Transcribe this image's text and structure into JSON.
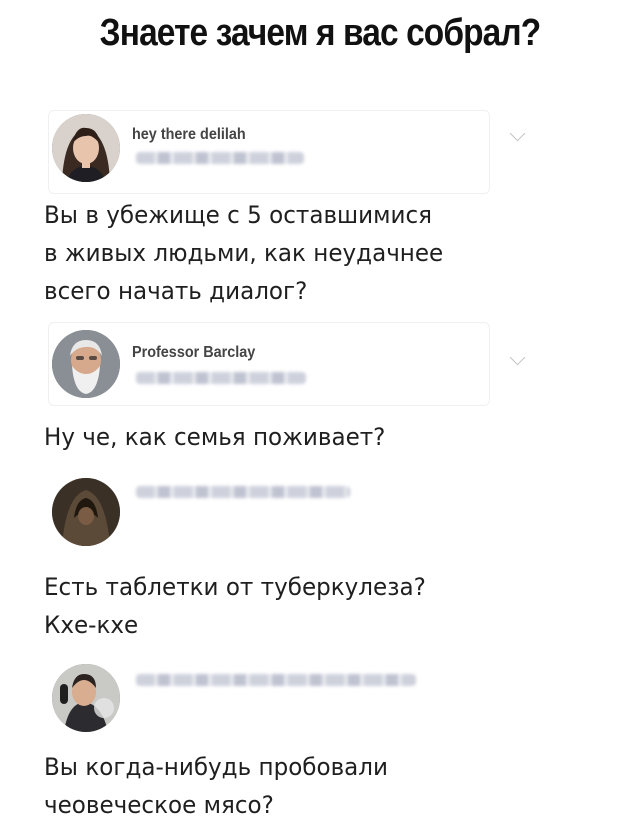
{
  "meme": {
    "title": "Знаете зачем я вас собрал?"
  },
  "posts": [
    {
      "username": "hey there delilah",
      "text": "Вы в убежище с 5 оставшимися\nв живых людьми, как неудачнее\nвсего начать диалог?",
      "avatar_icon": "woman-portrait-avatar"
    },
    {
      "username": "Professor Barclay",
      "text": "Ну че, как семья поживает?",
      "avatar_icon": "bearded-old-man-avatar"
    },
    {
      "username": "",
      "text": "Есть таблетки от туберкулеза?\nКхе-кхе",
      "avatar_icon": "hooded-figure-avatar"
    },
    {
      "username": "",
      "text": "Вы когда-нибудь пробовали\nчеовеческое мясо?",
      "avatar_icon": "man-smoking-avatar"
    }
  ]
}
